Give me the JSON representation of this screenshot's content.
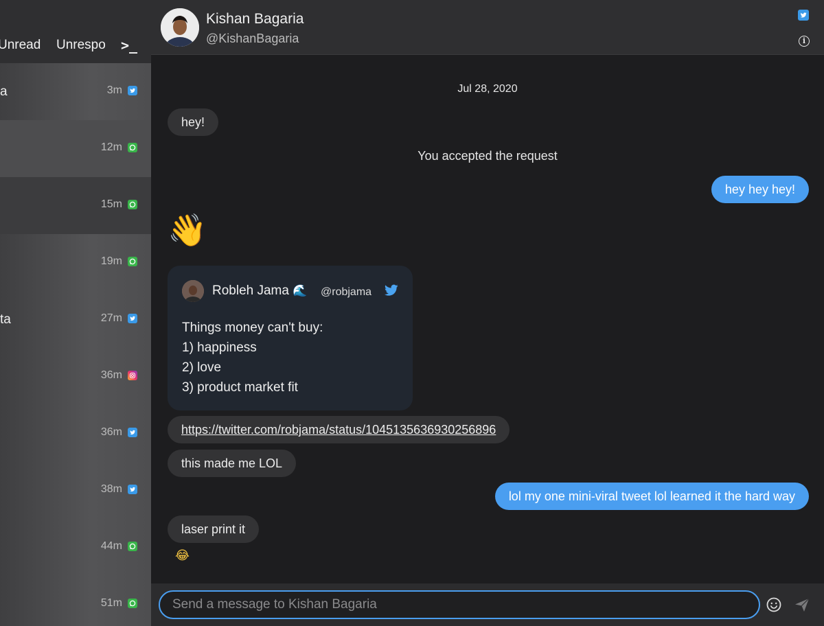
{
  "sidebar": {
    "tabs": [
      {
        "label": "Unread"
      },
      {
        "label": "Unrespo"
      },
      {
        "label": ">_"
      }
    ],
    "threads": [
      {
        "name": "a",
        "time": "3m",
        "service": "twitter"
      },
      {
        "name": "",
        "time": "12m",
        "service": "whatsapp"
      },
      {
        "name": "",
        "time": "15m",
        "service": "whatsapp"
      },
      {
        "name": "",
        "time": "19m",
        "service": "whatsapp"
      },
      {
        "name": "ta",
        "time": "27m",
        "service": "twitter"
      },
      {
        "name": "",
        "time": "36m",
        "service": "instagram"
      },
      {
        "name": "",
        "time": "36m",
        "service": "twitter"
      },
      {
        "name": "",
        "time": "38m",
        "service": "twitter"
      },
      {
        "name": "",
        "time": "44m",
        "service": "whatsapp"
      },
      {
        "name": "",
        "time": "51m",
        "service": "whatsapp"
      }
    ]
  },
  "header": {
    "name": "Kishan Bagaria",
    "handle": "@KishanBagaria",
    "service_icon": "twitter-icon",
    "info_icon": "info-icon"
  },
  "chat": {
    "date": "Jul 28, 2020",
    "messages": {
      "hey": "hey!",
      "system": "You accepted the request",
      "hey_hey_hey": "hey hey hey!",
      "wave": "👋",
      "link": "https://twitter.com/robjama/status/1045135636930256896",
      "lol": "this made me LOL",
      "reply": "lol my one mini-viral tweet lol learned it the hard way",
      "laser": "laser print it",
      "joy": "😂"
    },
    "tweet": {
      "author": "Robleh Jama",
      "author_emoji": "🌊",
      "handle": "@robjama",
      "lines": [
        "Things money can't buy:",
        "1) happiness",
        "2) love",
        "3) product market fit"
      ]
    }
  },
  "composer": {
    "placeholder": "Send a message to Kishan Bagaria",
    "value": ""
  },
  "colors": {
    "accent": "#4a9ef0",
    "twitter": "#3a9ae8",
    "whatsapp": "#39b54a"
  }
}
